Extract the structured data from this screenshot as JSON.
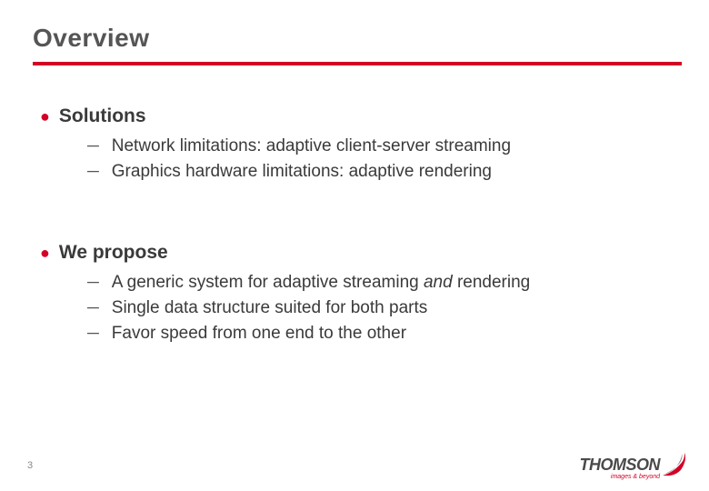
{
  "title": "Overview",
  "sections": [
    {
      "heading": "Solutions",
      "items": [
        "Network limitations: adaptive client-server streaming",
        "Graphics hardware limitations: adaptive rendering"
      ]
    },
    {
      "heading": "We propose",
      "items": [
        "A generic system for adaptive streaming <span class=\"em\">and</span> rendering",
        "Single data structure suited for both parts",
        "Favor speed from one end to the other"
      ]
    }
  ],
  "page_number": "3",
  "logo": {
    "brand": "THOMSON",
    "tagline": "images & beyond"
  }
}
